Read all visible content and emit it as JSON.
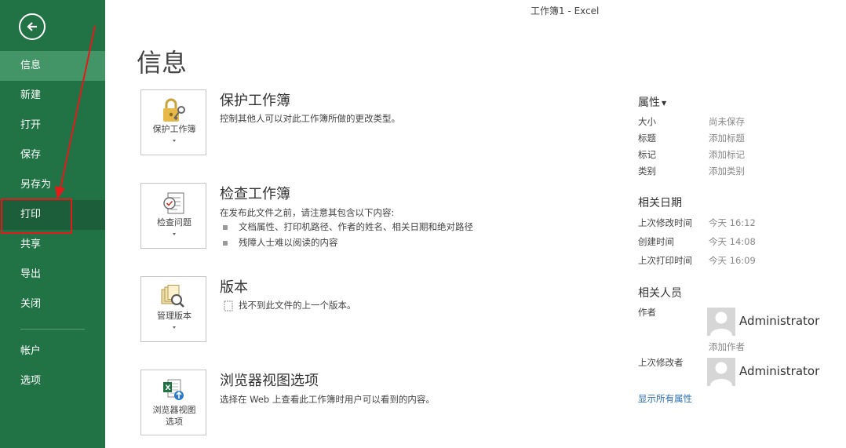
{
  "window": {
    "title": "工作簿1 - Excel"
  },
  "sidebar": {
    "items": [
      {
        "label": "信息"
      },
      {
        "label": "新建"
      },
      {
        "label": "打开"
      },
      {
        "label": "保存"
      },
      {
        "label": "另存为"
      },
      {
        "label": "打印"
      },
      {
        "label": "共享"
      },
      {
        "label": "导出"
      },
      {
        "label": "关闭"
      },
      {
        "label": "帐户"
      },
      {
        "label": "选项"
      }
    ],
    "active": "信息",
    "hover": "打印"
  },
  "page": {
    "title": "信息"
  },
  "sections": {
    "protect": {
      "tile_label": "保护工作簿",
      "title": "保护工作簿",
      "desc": "控制其他人可以对此工作簿所做的更改类型。",
      "icon": "lock-key-icon"
    },
    "inspect": {
      "tile_label": "检查问题",
      "title": "检查工作簿",
      "desc": "在发布此文件之前，请注意其包含以下内容:",
      "bullets": [
        "文档属性、打印机路径、作者的姓名、相关日期和绝对路径",
        "残障人士难以阅读的内容"
      ],
      "icon": "checklist-icon"
    },
    "versions": {
      "tile_label": "管理版本",
      "title": "版本",
      "desc": "找不到此文件的上一个版本。",
      "icon": "versions-search-icon"
    },
    "browser": {
      "tile_label_1": "浏览器视图",
      "tile_label_2": "选项",
      "title": "浏览器视图选项",
      "desc": "选择在 Web 上查看此工作簿时用户可以看到的内容。",
      "icon": "excel-web-icon"
    }
  },
  "properties": {
    "heading": "属性",
    "rows": [
      {
        "label": "大小",
        "value": "尚未保存"
      },
      {
        "label": "标题",
        "value": "添加标题"
      },
      {
        "label": "标记",
        "value": "添加标记"
      },
      {
        "label": "类别",
        "value": "添加类别"
      }
    ]
  },
  "dates": {
    "heading": "相关日期",
    "rows": [
      {
        "label": "上次修改时间",
        "value": "今天 16:12"
      },
      {
        "label": "创建时间",
        "value": "今天 14:08"
      },
      {
        "label": "上次打印时间",
        "value": "今天 16:09"
      }
    ]
  },
  "people": {
    "heading": "相关人员",
    "author_label": "作者",
    "author_name": "Administrator",
    "add_author": "添加作者",
    "last_modified_label": "上次修改者",
    "last_modified_name": "Administrator"
  },
  "show_all": "显示所有属性",
  "colors": {
    "sidebar": "#217346",
    "sidebar_active": "#439467",
    "sidebar_hover": "#1b5e39",
    "annotation": "#e21a1a",
    "link": "#2a6fb5"
  }
}
